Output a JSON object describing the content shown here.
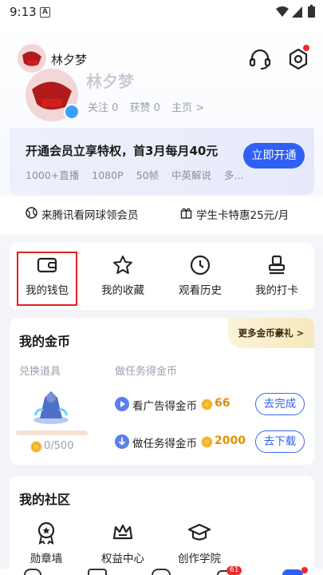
{
  "status_bar": {
    "time": "9:13",
    "app_icon_letter": "A"
  },
  "user": {
    "name": "林夕梦",
    "follow": "关注 0",
    "likes": "获赞 0",
    "homepage": "主页 >"
  },
  "vip": {
    "title": "开通会员立享特权，首3月每月40元",
    "features": [
      "1000+直播",
      "1080P",
      "50帧",
      "中英解说",
      "多..."
    ],
    "button": "立即开通"
  },
  "promos": {
    "left": "来腾讯看网球领会员",
    "right": "学生卡特惠25元/月"
  },
  "quick_links": [
    {
      "label": "我的钱包",
      "icon": "wallet-icon"
    },
    {
      "label": "我的收藏",
      "icon": "star-icon"
    },
    {
      "label": "观看历史",
      "icon": "clock-icon"
    },
    {
      "label": "我的打卡",
      "icon": "stamp-icon"
    }
  ],
  "coins": {
    "title": "我的金币",
    "more": "更多金币豪礼 >",
    "exchange_label": "兑换道具",
    "task_label": "做任务得金币",
    "balance": "0/500",
    "tasks": [
      {
        "label": "看广告得金币",
        "reward": "66",
        "button": "去完成"
      },
      {
        "label": "做任务得金币",
        "reward": "2000",
        "button": "去下载"
      }
    ]
  },
  "community": {
    "title": "我的社区",
    "items": [
      {
        "label": "勋章墙",
        "icon": "medal-icon"
      },
      {
        "label": "权益中心",
        "icon": "crown-icon"
      },
      {
        "label": "创作学院",
        "icon": "graduation-cap-icon"
      }
    ]
  },
  "bottom_nav_badge": "61",
  "colors": {
    "accent": "#2f5ff5",
    "highlight": "#e02020",
    "coin": "#e28f00"
  }
}
